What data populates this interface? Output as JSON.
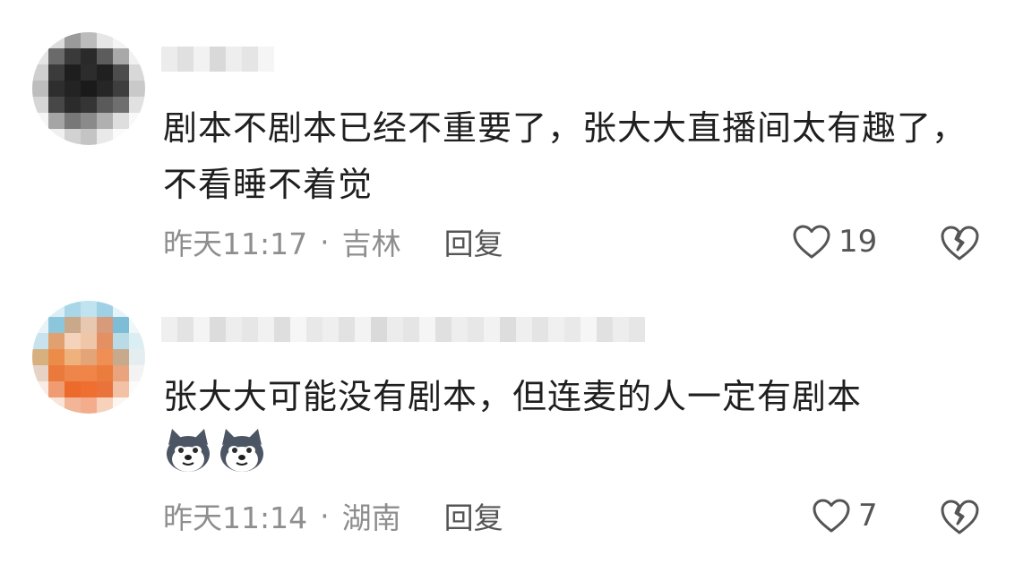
{
  "comments": [
    {
      "text": "剧本不剧本已经不重要了，张大大直播间太有趣了，不看睡不着觉",
      "time": "昨天11:17",
      "location": "吉林",
      "reply_label": "回复",
      "likes": "19",
      "avatar_colors": [
        "#f2f2f2",
        "#dcdcdc",
        "#9a9a9a",
        "#bcbcbc",
        "#e6e6e6",
        "#f4f4f4",
        "#ffffff",
        "#e4e4e4",
        "#6a6a6a",
        "#3a3a3a",
        "#2a2a2a",
        "#5c5c5c",
        "#a9a9a9",
        "#f1f1f1",
        "#cfcfcf",
        "#3b3b3b",
        "#1e1e1e",
        "#2c2c2c",
        "#202020",
        "#4d4d4d",
        "#d8d8d8",
        "#bdbdbd",
        "#2e2e2e",
        "#232323",
        "#1a1a1a",
        "#262626",
        "#3e3e3e",
        "#c9c9c9",
        "#d6d6d6",
        "#474747",
        "#2b2b2b",
        "#353535",
        "#5a5a5a",
        "#6f6f6f",
        "#e1e1e1",
        "#f6f6f6",
        "#a5a5a5",
        "#787878",
        "#8a8a8a",
        "#b0b0b0",
        "#dedede",
        "#f9f9f9",
        "#ffffff",
        "#f0f0f0",
        "#d2d2d2",
        "#c4c4c4",
        "#e9e9e9",
        "#fbfbfb",
        "#ffffff"
      ],
      "name_colors": [
        "#ececec",
        "#e0e0e0",
        "#f2f2f2",
        "#d9d9d9",
        "#eeeeee",
        "#e5e5e5",
        "#f5f5f5"
      ]
    },
    {
      "text": "张大大可能没有剧本，但连麦的人一定有剧本",
      "time": "昨天11:14",
      "location": "湖南",
      "reply_label": "回复",
      "likes": "7",
      "avatar_colors": [
        "#ffffff",
        "#dbeef5",
        "#a9d7e7",
        "#bfe3ef",
        "#9fd0e3",
        "#e6f4f8",
        "#ffffff",
        "#e9f3f6",
        "#8cc6dc",
        "#c9a98a",
        "#e8c8b0",
        "#d79a7a",
        "#7dbdd6",
        "#f0f7f9",
        "#c7e4ee",
        "#e0a070",
        "#f4d2bb",
        "#efc7a8",
        "#e39062",
        "#b9dbe6",
        "#dbeef3",
        "#d7b07f",
        "#ec8c4a",
        "#f0b27c",
        "#e3a578",
        "#ef8f55",
        "#c7a98b",
        "#e4eef1",
        "#e6d3c5",
        "#ea7a3c",
        "#ee854a",
        "#f18447",
        "#ea7c3e",
        "#e9a47d",
        "#f3f3f3",
        "#f8ece4",
        "#f09c72",
        "#ec6b2c",
        "#ef6f30",
        "#e9733a",
        "#f3c2a6",
        "#fbfbfb",
        "#ffffff",
        "#f9e4d8",
        "#f2b598",
        "#f3ad8d",
        "#f6d2bd",
        "#fdf5f0",
        "#ffffff"
      ],
      "name_colors": [
        "#efefef",
        "#e3e3e3",
        "#f4f4f4",
        "#dcdcdc",
        "#ededed",
        "#e6e6e6",
        "#f1f1f1",
        "#dedede",
        "#f6f6f6",
        "#e8e8e8",
        "#efefef",
        "#e2e2e2",
        "#f3f3f3",
        "#dadada",
        "#ececec",
        "#e5e5e5",
        "#f5f5f5",
        "#e0e0e0",
        "#eeeeee",
        "#e7e7e7",
        "#f2f2f2",
        "#dddddd",
        "#efefef",
        "#e4e4e4",
        "#f0f0f0",
        "#e9e9e9",
        "#f6f6f6",
        "#e1e1e1",
        "#ededed",
        "#e6e6e6"
      ]
    }
  ],
  "dot": "·",
  "icons": {
    "like": "heart-outline-icon",
    "dislike": "broken-heart-icon",
    "emoji": "dog-face-emoji"
  }
}
